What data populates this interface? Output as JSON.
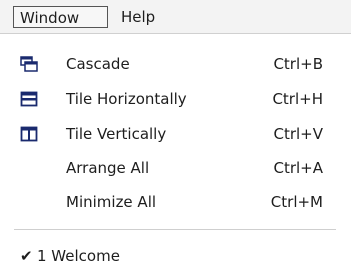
{
  "menubar": {
    "items": [
      {
        "label": "Window"
      },
      {
        "label": "Help"
      }
    ]
  },
  "menu": {
    "items": [
      {
        "label": "Cascade",
        "shortcut": "Ctrl+B",
        "icon": "cascade-icon"
      },
      {
        "label": "Tile Horizontally",
        "shortcut": "Ctrl+H",
        "icon": "tile-horizontal-icon"
      },
      {
        "label": "Tile Vertically",
        "shortcut": "Ctrl+V",
        "icon": "tile-vertical-icon"
      },
      {
        "label": "Arrange All",
        "shortcut": "Ctrl+A"
      },
      {
        "label": "Minimize All",
        "shortcut": "Ctrl+M"
      }
    ],
    "windows": [
      {
        "label": "1 Welcome",
        "checked": true,
        "check_glyph": "✔"
      }
    ]
  }
}
